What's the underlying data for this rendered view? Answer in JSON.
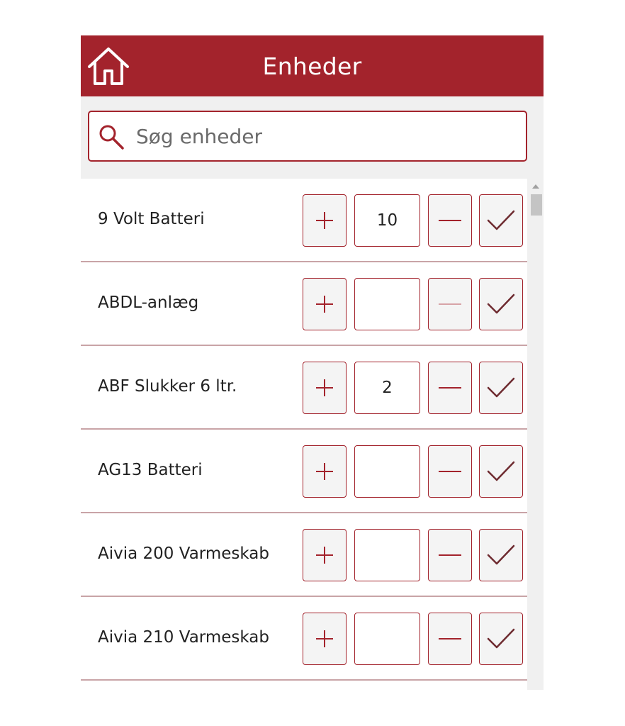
{
  "header": {
    "title": "Enheder",
    "home_icon": "home-icon"
  },
  "search": {
    "placeholder": "Søg enheder",
    "value": "",
    "icon": "search-icon"
  },
  "colors": {
    "accent": "#a3232c",
    "divider": "#c9a4a7",
    "background": "#f0f0f0"
  },
  "items": [
    {
      "label": "9 Volt Batteri",
      "quantity": "10"
    },
    {
      "label": "ABDL-anlæg",
      "quantity": ""
    },
    {
      "label": "ABF Slukker 6 ltr.",
      "quantity": "2"
    },
    {
      "label": "AG13 Batteri",
      "quantity": ""
    },
    {
      "label": "Aivia 200 Varmeskab",
      "quantity": ""
    },
    {
      "label": "Aivia 210 Varmeskab",
      "quantity": ""
    }
  ],
  "row_icons": {
    "add": "plus-icon",
    "remove": "minus-icon",
    "confirm": "check-icon"
  }
}
